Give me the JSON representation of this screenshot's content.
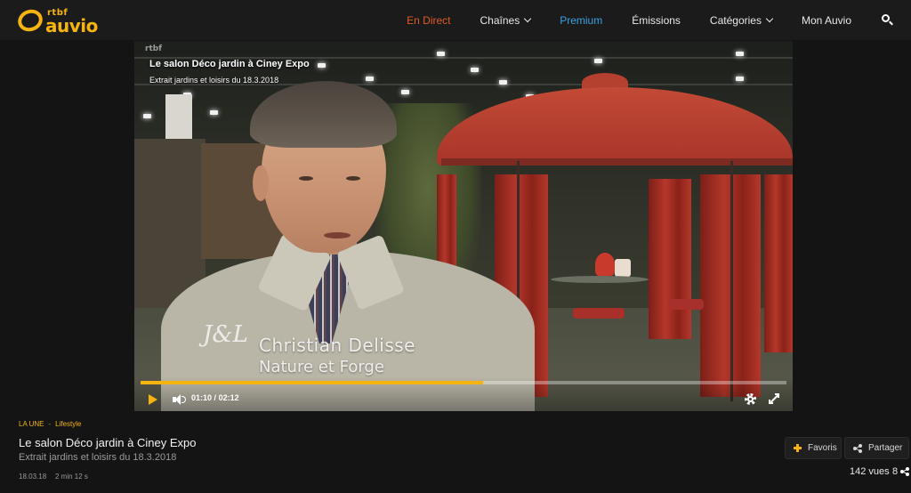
{
  "brand": {
    "logo_small": "rtbf",
    "logo_main": "auvio",
    "color": "#f5b40f"
  },
  "nav": {
    "items": [
      {
        "label": "En Direct",
        "color": "#e05a24"
      },
      {
        "label": "Chaînes",
        "has_dropdown": true
      },
      {
        "label": "Premium",
        "color": "#3aa3e3"
      },
      {
        "label": "Émissions"
      },
      {
        "label": "Catégories",
        "has_dropdown": true
      },
      {
        "label": "Mon Auvio"
      }
    ],
    "search_icon": "search-icon"
  },
  "player": {
    "overlay_title": "Le salon Déco jardin à Ciney Expo",
    "overlay_subtitle": "Extrait jardins et loisirs du 18.3.2018",
    "watermark": "rtbf",
    "lower_third": {
      "logo": "J&L",
      "name": "Christian Delisse",
      "company": "Nature et Forge"
    },
    "controls": {
      "current_time": "01:10",
      "separator": "/",
      "duration": "02:12",
      "progress": 0.53,
      "accent": "#f5b40f"
    }
  },
  "info": {
    "breadcrumb": [
      "LA UNE",
      "Lifestyle"
    ],
    "title": "Le salon Déco jardin à Ciney Expo",
    "subtitle": "Extrait jardins et loisirs du 18.3.2018",
    "date": "18.03.18",
    "duration": "2 min 12 s",
    "favorites_label": "Favoris",
    "share_label": "Partager",
    "views": "142 vues",
    "shares_count": "8"
  }
}
